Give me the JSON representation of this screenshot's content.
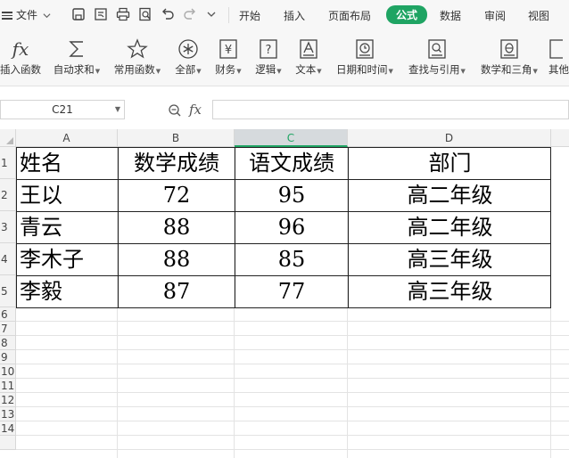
{
  "menu": {
    "file_label": "文件",
    "tabs": [
      "开始",
      "插入",
      "页面布局",
      "公式",
      "数据",
      "审阅",
      "视图"
    ],
    "active_tab": "公式"
  },
  "ribbon": {
    "buttons": [
      {
        "label": "插入函数",
        "icon": "fx-icon",
        "dropdown": false
      },
      {
        "label": "自动求和",
        "icon": "sigma-icon",
        "dropdown": true
      },
      {
        "label": "常用函数",
        "icon": "star-icon",
        "dropdown": true
      },
      {
        "label": "全部",
        "icon": "asterisk-circle-icon",
        "dropdown": true
      },
      {
        "label": "财务",
        "icon": "yen-icon",
        "dropdown": true
      },
      {
        "label": "逻辑",
        "icon": "question-icon",
        "dropdown": true
      },
      {
        "label": "文本",
        "icon": "text-a-icon",
        "dropdown": true
      },
      {
        "label": "日期和时间",
        "icon": "clock-icon",
        "dropdown": true
      },
      {
        "label": "查找与引用",
        "icon": "search-doc-icon",
        "dropdown": true
      },
      {
        "label": "数学和三角",
        "icon": "theta-icon",
        "dropdown": true
      },
      {
        "label": "其他",
        "icon": "more-icon",
        "dropdown": false
      }
    ]
  },
  "formula_bar": {
    "cell_ref": "C21",
    "fx_label": "fx",
    "value": ""
  },
  "grid": {
    "columns": [
      "A",
      "B",
      "C",
      "D"
    ],
    "selected_column": "C",
    "row_numbers": [
      "1",
      "2",
      "3",
      "4",
      "5",
      "6",
      "7",
      "8",
      "9",
      "10",
      "11",
      "12",
      "13",
      "14"
    ],
    "table": [
      [
        "姓名",
        "数学成绩",
        "语文成绩",
        "部门"
      ],
      [
        "王以",
        "72",
        "95",
        "高二年级"
      ],
      [
        "青云",
        "88",
        "96",
        "高二年级"
      ],
      [
        "李木子",
        "88",
        "85",
        "高三年级"
      ],
      [
        "李毅",
        "87",
        "77",
        "高三年级"
      ]
    ]
  },
  "colors": {
    "accent": "#1fa463"
  }
}
